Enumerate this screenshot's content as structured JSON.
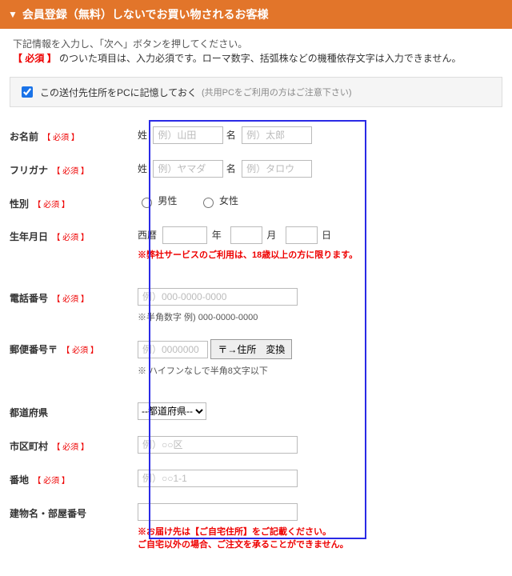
{
  "header": {
    "title": "会員登録（無料）しないでお買い物されるお客様"
  },
  "instructions": {
    "line1": "下記情報を入力し、「次へ」ボタンを押してください。",
    "required_badge": "【 必須 】",
    "line2_tail": " のついた項目は、入力必須です。ローマ数字、括弧株などの機種依存文字は入力できません。"
  },
  "remember": {
    "checked": true,
    "label": "この送付先住所をPCに記憶しておく",
    "note": "(共用PCをご利用の方はご注意下さい)"
  },
  "required_text": "【 必須 】",
  "fields": {
    "name": {
      "label": "お名前",
      "sei_label": "姓",
      "sei_ph": "例）山田",
      "mei_label": "名",
      "mei_ph": "例）太郎"
    },
    "kana": {
      "label": "フリガナ",
      "sei_label": "姓",
      "sei_ph": "例）ヤマダ",
      "mei_label": "名",
      "mei_ph": "例）タロウ"
    },
    "gender": {
      "label": "性別",
      "male": "男性",
      "female": "女性"
    },
    "dob": {
      "label": "生年月日",
      "era": "西暦",
      "y": "年",
      "m": "月",
      "d": "日",
      "warn": "※弊社サービスのご利用は、18歳以上の方に限ります。"
    },
    "phone": {
      "label": "電話番号",
      "ph": "例）000-0000-0000",
      "hint": "※半角数字 例) 000-0000-0000"
    },
    "zip": {
      "label": "郵便番号〒",
      "ph": "例）0000000",
      "btn": "〒→住所　変換",
      "hint": "※ ハイフンなしで半角8文字以下"
    },
    "pref": {
      "label": "都道府県",
      "selected": "--都道府県--"
    },
    "city": {
      "label": "市区町村",
      "ph": "例）○○区"
    },
    "street": {
      "label": "番地",
      "ph": "例）○○1-1"
    },
    "building": {
      "label": "建物名・部屋番号",
      "warn1": "※お届け先は【ご自宅住所】をご記載ください。",
      "warn2": "ご自宅以外の場合、ご注文を承ることができません。"
    }
  }
}
